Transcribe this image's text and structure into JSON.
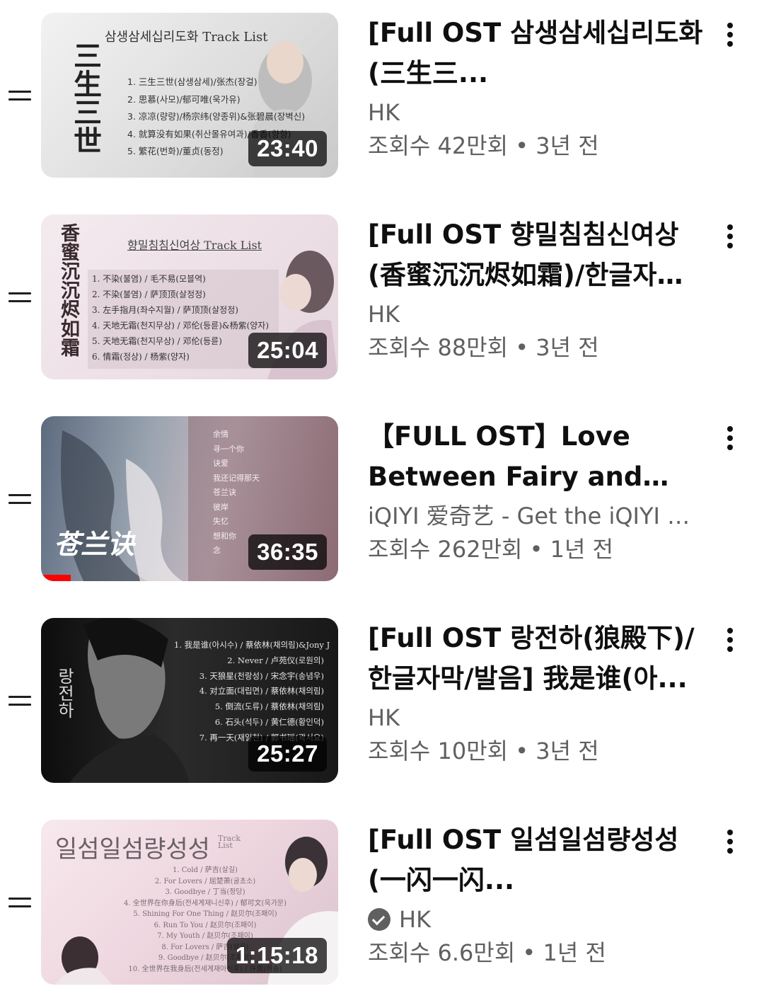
{
  "videos": [
    {
      "title": "[Full OST 삼생삼세십리도화(三生三...",
      "channel": "HK",
      "verified": false,
      "stats": "조회수 42만회 • 3년 전",
      "duration": "23:40",
      "thumb_heading": "삼생삼세십리도화 Track List",
      "thumb_side": "三生三世",
      "thumb_tracks": [
        "1. 三生三世(삼생삼세)/张杰(장걸)",
        "2. 思慕(사모)/郁可唯(욱가유)",
        "3. 凉凉(량량)/杨宗纬(양종위)&张碧晨(장벽신)",
        "4. 就算没有如果(취산몰유여과)/香香(향향)",
        "5. 繁花(번화)/董贞(동정)"
      ]
    },
    {
      "title": "[Full OST 향밀침침신여상(香蜜沉沉烬如霜)/한글자막/...",
      "channel": "HK",
      "verified": false,
      "stats": "조회수 88만회 • 3년 전",
      "duration": "25:04",
      "thumb_heading": "향밀침침신여상 Track List",
      "thumb_side": "香蜜沉沉烬如霜",
      "thumb_tracks": [
        "1. 不染(불염) / 毛不易(모블역)",
        "2. 不染(불염) / 萨顶顶(살정정)",
        "3. 左手指月(좌수지월) / 萨顶顶(살정정)",
        "4. 天地无霜(천지무상) / 邓伦(등륜)&杨紫(양자)",
        "5. 天地无霜(천지무상) / 邓伦(등륜)",
        "6. 情霜(정상) / 杨紫(양자)"
      ]
    },
    {
      "title": "【FULL OST】Love Between Fairy and Devil |...",
      "channel": "iQIYI 爱奇艺 - Get the iQIYI A...",
      "verified": false,
      "stats": "조회수 262만회 • 1년 전",
      "duration": "36:35",
      "thumb_side": "苍兰诀",
      "thumb_tracks": [
        "余情",
        "寻一个你",
        "诀爱",
        "我还记得那天",
        "苍兰诀",
        "彼岸",
        "失忆",
        "想和你",
        "念"
      ],
      "progress": 0.1
    },
    {
      "title": "[Full OST 랑전하(狼殿下)/한글자막/발음] 我是谁(아...",
      "channel": "HK",
      "verified": false,
      "stats": "조회수 10만회 • 3년 전",
      "duration": "25:27",
      "thumb_side": "랑전하",
      "thumb_tracks": [
        "1. 我是谁(아시수) / 蔡依林(채의림)&Jony J",
        "2. Never / 卢苑仪(로원의)",
        "3. 天狼星(천랑성) / 宋念宇(송념우)",
        "4. 对立面(대립면) / 蔡依林(채의림)",
        "5. 倒流(도류) / 蔡依林(채의림)",
        "6. 石头(석두) / 黄仁德(황인덕)",
        "7. 再一天(재일천) / 郭书瑶(곽서요)"
      ]
    },
    {
      "title": "[Full OST 일섬일섬량성성(一闪一闪...",
      "channel": "HK",
      "verified": true,
      "stats": "조회수 6.6만회 • 1년 전",
      "duration": "1:15:18",
      "thumb_heading": "일섬일섬량성성",
      "thumb_heading_small": "Track List",
      "thumb_tracks": [
        "1. Cold / 萨吉(살길)",
        "2. For Lovers / 屈楚萧(굴초소)",
        "3. Goodbye / 丁当(정당)",
        "4. 全世界在你身后(전세계재니신후) / 郁可文(욱가문)",
        "5. Shining For One Thing / 赵贝尔(조패이)",
        "6. Run To You / 赵贝尔(조패이)",
        "7. My Youth / 赵贝尔(조패이)",
        "8. For Lovers / 萨吉(살길)",
        "9. Goodbye / 赵贝尔(조패이)",
        "10. 全世界在我身后(전세계재아신후) / 许嵩(허송)"
      ]
    }
  ],
  "colors": {
    "progress": "#ff0000",
    "meta": "#606060",
    "text": "#0f0f0f"
  },
  "icons": {
    "drag": "drag-handle-icon",
    "more": "more-vert-icon",
    "verified": "verified-check-icon"
  }
}
